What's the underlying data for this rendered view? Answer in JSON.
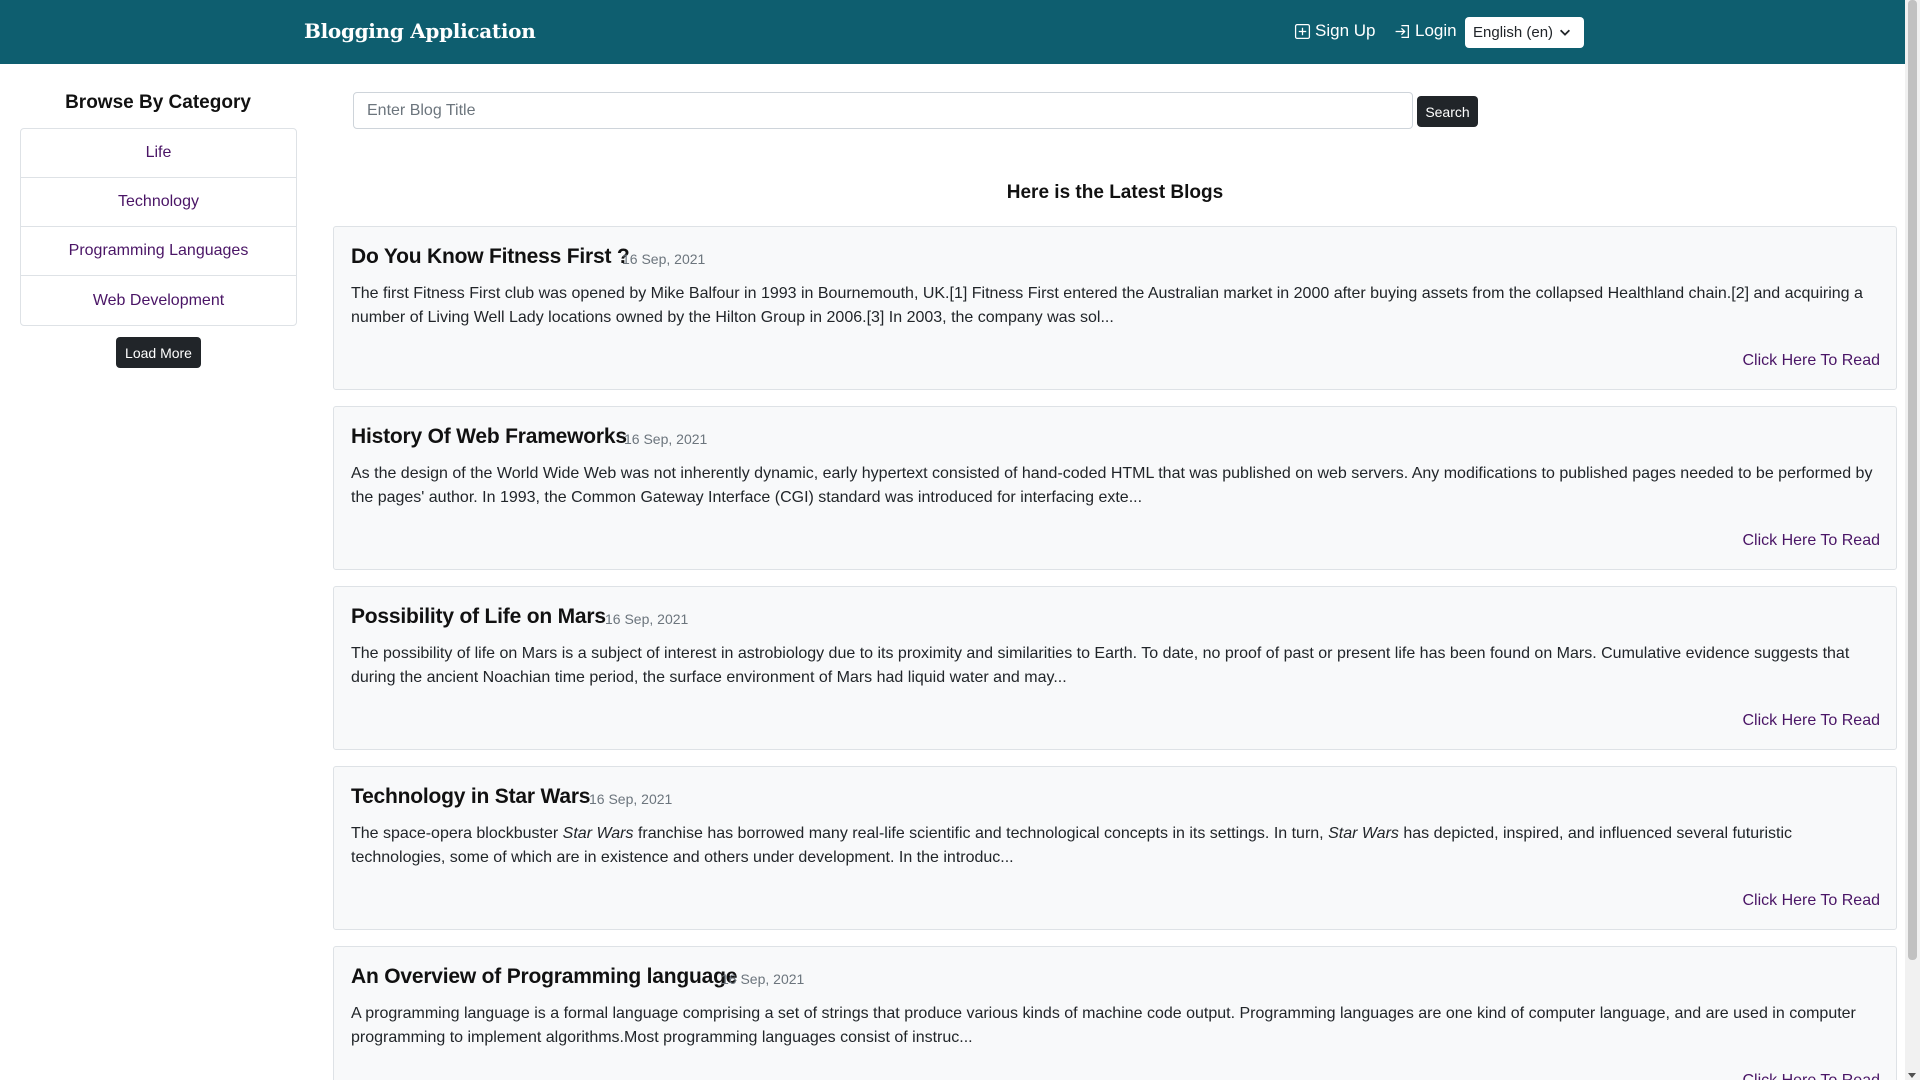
{
  "navbar": {
    "brand": "Blogging Application",
    "signup_label": "Sign Up",
    "login_label": "Login",
    "language_selected": "English (en)",
    "bg_color": "#0e5e6f"
  },
  "sidebar": {
    "title": "Browse By Category",
    "categories": [
      "Life",
      "Technology",
      "Programming Languages",
      "Web Development"
    ],
    "load_more_label": "Load More"
  },
  "search": {
    "placeholder": "Enter Blog Title",
    "button_label": "Search"
  },
  "main": {
    "heading": "Here is the Latest Blogs",
    "blogs": [
      {
        "title": "Do You Know Fitness First ?",
        "date": "16 Sep, 2021",
        "excerpt": "The first Fitness First club was opened by Mike Balfour in 1993 in Bournemouth, UK.[1] Fitness First entered the Australian market in 2000 after buying assets from the collapsed Healthland chain.[2] and acquiring a number of Living Well Lady locations owned by the Hilton Group in 2006.[3] In 2003, the company was sol...",
        "link_label": "Click Here To Read"
      },
      {
        "title": "History Of Web Frameworks",
        "date": "16 Sep, 2021",
        "excerpt": "As the design of the World Wide Web was not inherently dynamic, early hypertext consisted of hand-coded HTML that was published on web servers. Any modifications to published pages needed to be performed by the pages' author. In 1993, the Common Gateway Interface (CGI) standard was introduced for interfacing exte...",
        "link_label": "Click Here To Read"
      },
      {
        "title": "Possibility of Life on Mars",
        "date": "16 Sep, 2021",
        "excerpt": "The possibility of life on Mars is a subject of interest in astrobiology due to its proximity and similarities to Earth. To date, no proof of past or present life has been found on Mars. Cumulative evidence suggests that during the ancient Noachian time period, the surface environment of Mars had liquid water and may...",
        "link_label": "Click Here To Read"
      },
      {
        "title": "Technology in Star Wars",
        "date": "16 Sep, 2021",
        "excerpt_parts": [
          "The space-opera blockbuster ",
          "Star Wars",
          " franchise has borrowed many real-life scientific and technological concepts in its settings. In turn, ",
          "Star Wars",
          " has depicted, inspired, and influenced several futuristic technologies, some of which are in existence and others under development. In the introduc..."
        ],
        "link_label": "Click Here To Read"
      },
      {
        "title": "An Overview of Programming language",
        "date": "16 Sep, 2021",
        "excerpt": "A programming language is a formal language comprising a set of strings that produce various kinds of machine code output. Programming languages are one kind of computer language, and are used in computer programming to implement algorithms.Most programming languages consist of instruc...",
        "link_label": "Click Here To Read"
      }
    ]
  }
}
